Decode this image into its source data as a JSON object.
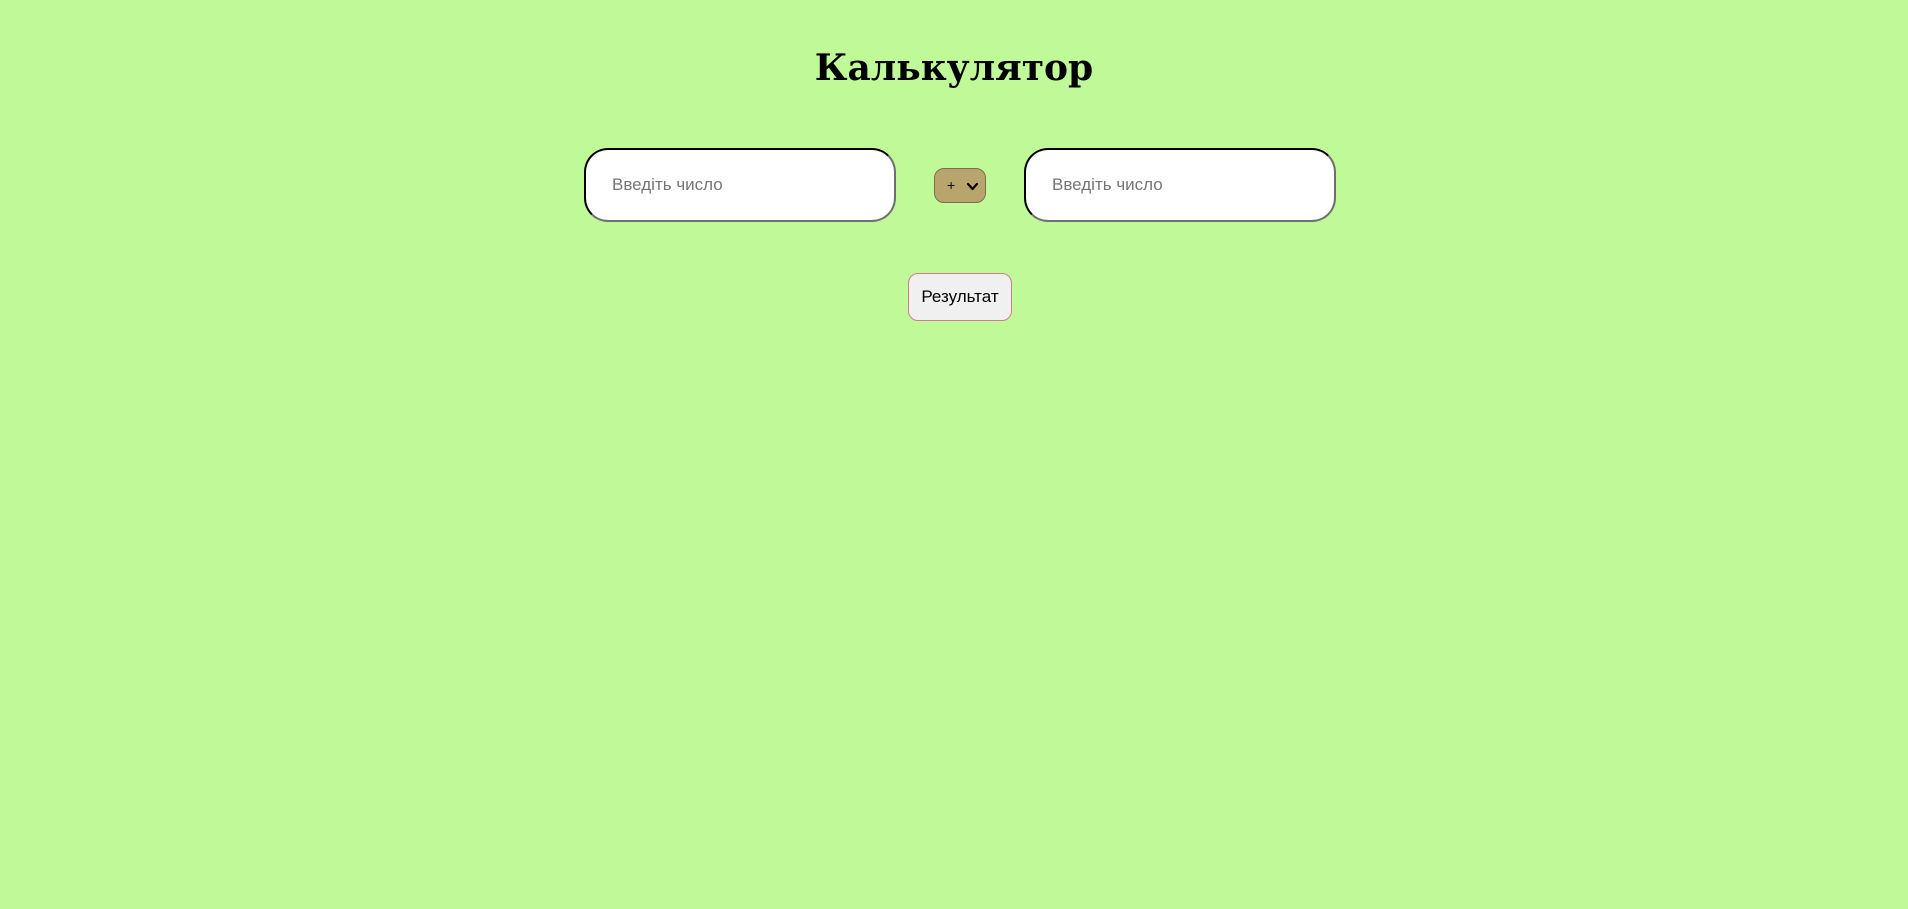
{
  "page": {
    "title": "Калькулятор",
    "background_color": "#c0fa98"
  },
  "calculator": {
    "first_number": {
      "value": "",
      "placeholder": "Введіть число"
    },
    "operator": {
      "selected": "+",
      "icon": "chevron-down-icon",
      "color": "#b8a56b"
    },
    "second_number": {
      "value": "",
      "placeholder": "Введіть число"
    },
    "result_button": {
      "label": "Результат"
    }
  }
}
